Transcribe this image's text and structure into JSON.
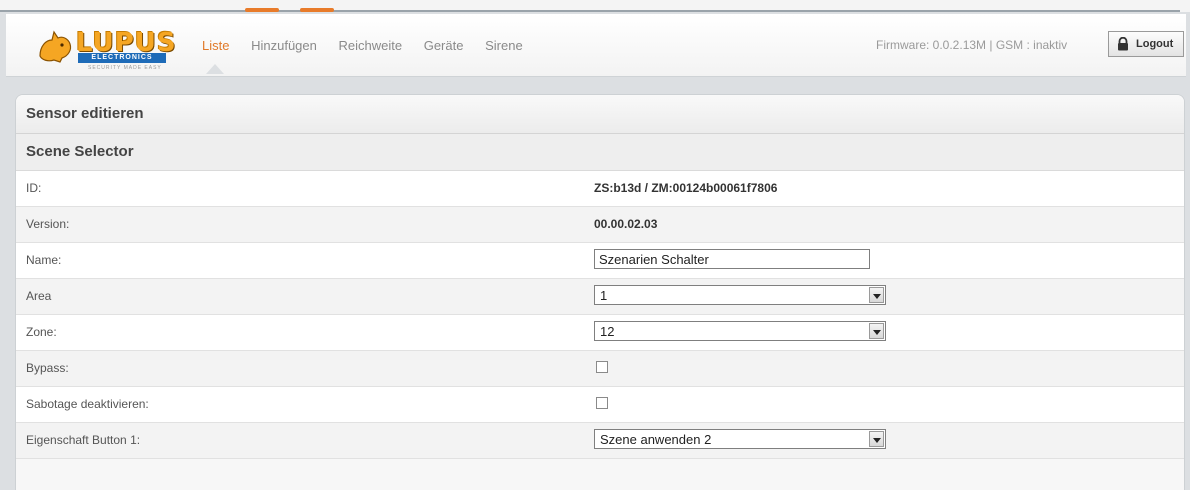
{
  "brand": {
    "name": "LUPUS",
    "sub": "ELECTRONICS",
    "tagline": "SECURITY MADE EASY"
  },
  "nav": {
    "items": [
      "Liste",
      "Hinzufügen",
      "Reichweite",
      "Geräte",
      "Sirene"
    ],
    "active": "Liste"
  },
  "status": {
    "firmware": "Firmware: 0.0.2.13M | GSM : inaktiv"
  },
  "logout": {
    "label": "Logout",
    "icon": "lock-icon"
  },
  "panel": {
    "title": "Sensor editieren",
    "section": "Scene Selector"
  },
  "fields": {
    "id": {
      "label": "ID:",
      "value": "ZS:b13d / ZM:00124b00061f7806"
    },
    "version": {
      "label": "Version:",
      "value": "00.00.02.03"
    },
    "name": {
      "label": "Name:",
      "value": "Szenarien Schalter"
    },
    "area": {
      "label": "Area",
      "value": "1"
    },
    "zone": {
      "label": "Zone:",
      "value": "12"
    },
    "bypass": {
      "label": "Bypass:",
      "checked": false
    },
    "sabotage": {
      "label": "Sabotage deaktivieren:",
      "checked": false
    },
    "button1": {
      "label": "Eigenschaft Button 1:",
      "value": "Szene anwenden 2"
    }
  },
  "colors": {
    "accent": "#e07a2a",
    "brand_yellow": "#f5a623",
    "brand_blue": "#1e6bb8"
  }
}
